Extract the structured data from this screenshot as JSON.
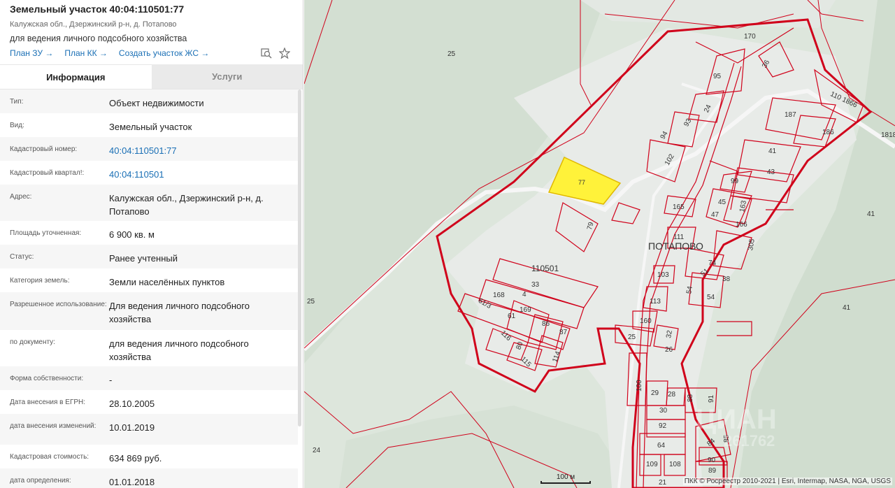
{
  "header": {
    "title": "Земельный участок 40:04:110501:77",
    "address": "Калужская обл., Дзержинский р-н, д. Потапово",
    "purpose": "для ведения личного подсобного хозяйства",
    "links": [
      "План ЗУ →",
      "План КК →",
      "Создать участок ЖС →"
    ],
    "icons": [
      "search-map-icon",
      "star-icon"
    ]
  },
  "tabs": [
    {
      "label": "Информация",
      "active": true
    },
    {
      "label": "Услуги",
      "active": false
    }
  ],
  "info": [
    {
      "label": "Тип:",
      "value": "Объект недвижимости"
    },
    {
      "label": "Вид:",
      "value": "Земельный участок"
    },
    {
      "label": "Кадастровый номер:",
      "value": "40:04:110501:77"
    },
    {
      "label": "Кадастровый квартал!:",
      "value": "40:04:110501"
    },
    {
      "label": "Адрес:",
      "value": "Калужская обл., Дзержинский р-н, д. Потапово"
    },
    {
      "label": "Площадь уточненная:",
      "value": "6 900 кв. м"
    },
    {
      "label": "Статус:",
      "value": "Ранее учтенный"
    },
    {
      "label": "Категория земель:",
      "value": "Земли населённых пунктов"
    },
    {
      "label": "Разрешенное использование:",
      "value": "Для ведения личного подсобного хозяйства"
    },
    {
      "label": "по документу:",
      "value": "для ведения личного подсобного хозяйства"
    },
    {
      "label": "Форма собственности:",
      "value": "-"
    },
    {
      "label": "Дата внесения в ЕГРН:",
      "value": "28.10.2005"
    },
    {
      "label": "дата внесения изменений:",
      "value": "10.01.2019"
    },
    {
      "label": "Кадастровая стоимость:",
      "value": "634 869 руб."
    },
    {
      "label": "дата определения:",
      "value": "01.01.2018"
    }
  ],
  "map": {
    "village_label": "ПОТАПОВО",
    "quarter_label": "110501",
    "selected_parcel": "77",
    "scale": "100 м",
    "attribution": "ПКК © Росреестр 2010-2021 | Esri, Intermap, NASA, NGA, USGS",
    "watermark": "ЦИАН",
    "watermark_id": "261762",
    "parcel_labels": [
      "25",
      "170",
      "36",
      "95",
      "24",
      "93",
      "94",
      "102",
      "110 1866",
      "187",
      "186",
      "1818",
      "41",
      "43",
      "99",
      "45",
      "163",
      "47",
      "166",
      "165",
      "111",
      "305",
      "74",
      "51",
      "38",
      "103",
      "54",
      "54",
      "113",
      "160",
      "32",
      "25",
      "26",
      "33",
      "4",
      "168",
      "61/3",
      "169",
      "61",
      "86",
      "87",
      "116",
      "80",
      "115",
      "114",
      "79",
      "100",
      "29",
      "28",
      "88",
      "91",
      "30",
      "92",
      "64",
      "84",
      "85",
      "90",
      "89",
      "109",
      "108",
      "21",
      "24",
      "25",
      "41",
      "41",
      "110501"
    ],
    "colors": {
      "parcel_stroke": "#d0021b",
      "selected_fill": "#fff23a",
      "background": "#dde6dc"
    }
  }
}
